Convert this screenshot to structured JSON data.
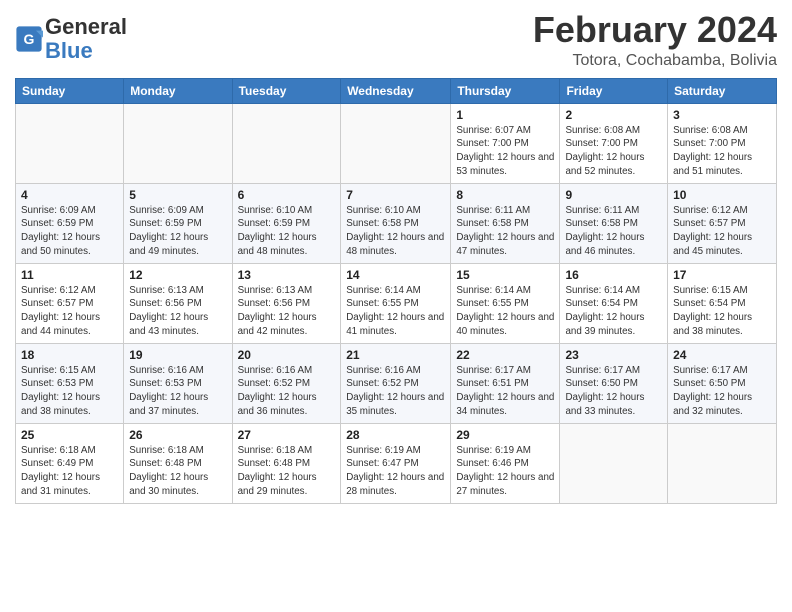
{
  "header": {
    "logo_general": "General",
    "logo_blue": "Blue",
    "month_year": "February 2024",
    "location": "Totora, Cochabamba, Bolivia"
  },
  "weekdays": [
    "Sunday",
    "Monday",
    "Tuesday",
    "Wednesday",
    "Thursday",
    "Friday",
    "Saturday"
  ],
  "weeks": [
    [
      {
        "day": null
      },
      {
        "day": null
      },
      {
        "day": null
      },
      {
        "day": null
      },
      {
        "day": "1",
        "sunrise": "6:07 AM",
        "sunset": "7:00 PM",
        "daylight": "12 hours and 53 minutes."
      },
      {
        "day": "2",
        "sunrise": "6:08 AM",
        "sunset": "7:00 PM",
        "daylight": "12 hours and 52 minutes."
      },
      {
        "day": "3",
        "sunrise": "6:08 AM",
        "sunset": "7:00 PM",
        "daylight": "12 hours and 51 minutes."
      }
    ],
    [
      {
        "day": "4",
        "sunrise": "6:09 AM",
        "sunset": "6:59 PM",
        "daylight": "12 hours and 50 minutes."
      },
      {
        "day": "5",
        "sunrise": "6:09 AM",
        "sunset": "6:59 PM",
        "daylight": "12 hours and 49 minutes."
      },
      {
        "day": "6",
        "sunrise": "6:10 AM",
        "sunset": "6:59 PM",
        "daylight": "12 hours and 48 minutes."
      },
      {
        "day": "7",
        "sunrise": "6:10 AM",
        "sunset": "6:58 PM",
        "daylight": "12 hours and 48 minutes."
      },
      {
        "day": "8",
        "sunrise": "6:11 AM",
        "sunset": "6:58 PM",
        "daylight": "12 hours and 47 minutes."
      },
      {
        "day": "9",
        "sunrise": "6:11 AM",
        "sunset": "6:58 PM",
        "daylight": "12 hours and 46 minutes."
      },
      {
        "day": "10",
        "sunrise": "6:12 AM",
        "sunset": "6:57 PM",
        "daylight": "12 hours and 45 minutes."
      }
    ],
    [
      {
        "day": "11",
        "sunrise": "6:12 AM",
        "sunset": "6:57 PM",
        "daylight": "12 hours and 44 minutes."
      },
      {
        "day": "12",
        "sunrise": "6:13 AM",
        "sunset": "6:56 PM",
        "daylight": "12 hours and 43 minutes."
      },
      {
        "day": "13",
        "sunrise": "6:13 AM",
        "sunset": "6:56 PM",
        "daylight": "12 hours and 42 minutes."
      },
      {
        "day": "14",
        "sunrise": "6:14 AM",
        "sunset": "6:55 PM",
        "daylight": "12 hours and 41 minutes."
      },
      {
        "day": "15",
        "sunrise": "6:14 AM",
        "sunset": "6:55 PM",
        "daylight": "12 hours and 40 minutes."
      },
      {
        "day": "16",
        "sunrise": "6:14 AM",
        "sunset": "6:54 PM",
        "daylight": "12 hours and 39 minutes."
      },
      {
        "day": "17",
        "sunrise": "6:15 AM",
        "sunset": "6:54 PM",
        "daylight": "12 hours and 38 minutes."
      }
    ],
    [
      {
        "day": "18",
        "sunrise": "6:15 AM",
        "sunset": "6:53 PM",
        "daylight": "12 hours and 38 minutes."
      },
      {
        "day": "19",
        "sunrise": "6:16 AM",
        "sunset": "6:53 PM",
        "daylight": "12 hours and 37 minutes."
      },
      {
        "day": "20",
        "sunrise": "6:16 AM",
        "sunset": "6:52 PM",
        "daylight": "12 hours and 36 minutes."
      },
      {
        "day": "21",
        "sunrise": "6:16 AM",
        "sunset": "6:52 PM",
        "daylight": "12 hours and 35 minutes."
      },
      {
        "day": "22",
        "sunrise": "6:17 AM",
        "sunset": "6:51 PM",
        "daylight": "12 hours and 34 minutes."
      },
      {
        "day": "23",
        "sunrise": "6:17 AM",
        "sunset": "6:50 PM",
        "daylight": "12 hours and 33 minutes."
      },
      {
        "day": "24",
        "sunrise": "6:17 AM",
        "sunset": "6:50 PM",
        "daylight": "12 hours and 32 minutes."
      }
    ],
    [
      {
        "day": "25",
        "sunrise": "6:18 AM",
        "sunset": "6:49 PM",
        "daylight": "12 hours and 31 minutes."
      },
      {
        "day": "26",
        "sunrise": "6:18 AM",
        "sunset": "6:48 PM",
        "daylight": "12 hours and 30 minutes."
      },
      {
        "day": "27",
        "sunrise": "6:18 AM",
        "sunset": "6:48 PM",
        "daylight": "12 hours and 29 minutes."
      },
      {
        "day": "28",
        "sunrise": "6:19 AM",
        "sunset": "6:47 PM",
        "daylight": "12 hours and 28 minutes."
      },
      {
        "day": "29",
        "sunrise": "6:19 AM",
        "sunset": "6:46 PM",
        "daylight": "12 hours and 27 minutes."
      },
      {
        "day": null
      },
      {
        "day": null
      }
    ]
  ],
  "labels": {
    "sunrise_prefix": "Sunrise: ",
    "sunset_prefix": "Sunset: ",
    "daylight_prefix": "Daylight: "
  }
}
